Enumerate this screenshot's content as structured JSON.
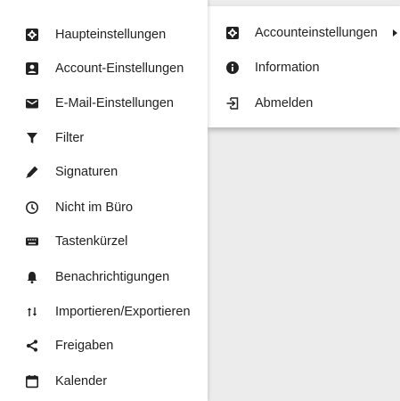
{
  "left_menu": {
    "items": [
      {
        "label": "Haupteinstellungen",
        "icon": "gear-box-icon"
      },
      {
        "label": "Account-Einstellungen",
        "icon": "account-box-icon"
      },
      {
        "label": "E-Mail-Einstellungen",
        "icon": "email-icon"
      },
      {
        "label": "Filter",
        "icon": "filter-icon"
      },
      {
        "label": "Signaturen",
        "icon": "pen-icon"
      },
      {
        "label": "Nicht im Büro",
        "icon": "clock-icon"
      },
      {
        "label": "Tastenkürzel",
        "icon": "keyboard-icon"
      },
      {
        "label": "Benachrichtigungen",
        "icon": "bell-icon"
      },
      {
        "label": "Importieren/Exportieren",
        "icon": "import-export-icon"
      },
      {
        "label": "Freigaben",
        "icon": "share-icon"
      },
      {
        "label": "Kalender",
        "icon": "calendar-icon"
      }
    ]
  },
  "right_menu": {
    "items": [
      {
        "label": "Accounteinstellungen",
        "icon": "gear-box-icon",
        "has_submenu": true
      },
      {
        "label": "Information",
        "icon": "info-icon"
      },
      {
        "label": "Abmelden",
        "icon": "logout-icon"
      }
    ]
  },
  "colors": {
    "icon": "#222222",
    "background": "#ececec",
    "menu_background": "#ffffff"
  }
}
